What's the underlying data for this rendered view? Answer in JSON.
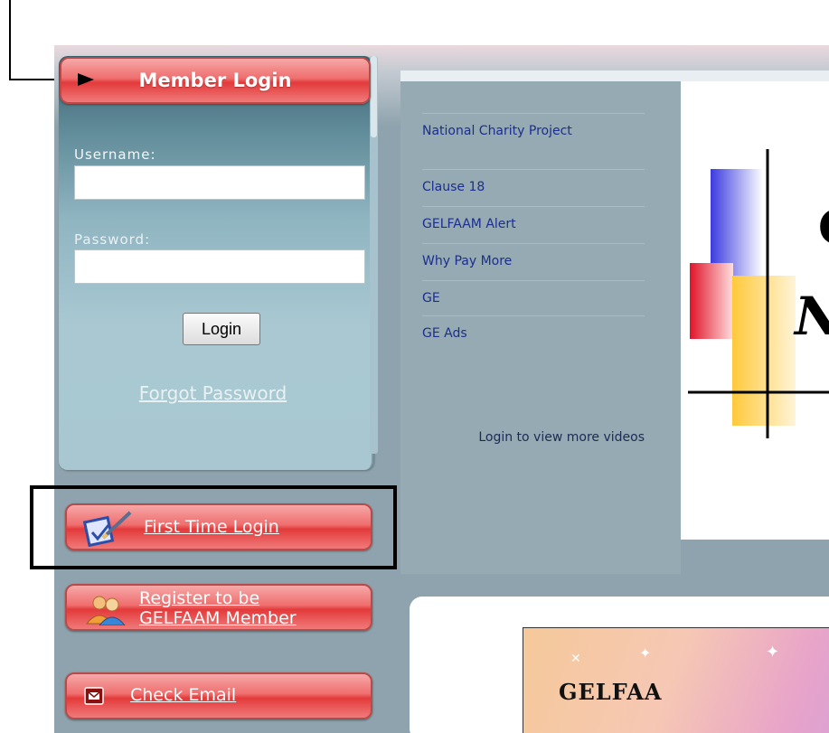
{
  "sidebar": {
    "member_login_title": "Member Login",
    "username_label": "Username:",
    "password_label": "Password:",
    "username_value": "",
    "password_value": "",
    "login_button": "Login",
    "forgot_password": "Forgot Password",
    "first_time_login": "First Time Login",
    "register_line1": "Register to be",
    "register_line2": "GELFAAM Member",
    "check_email": "Check Email"
  },
  "videos": {
    "items": [
      {
        "label": "National Charity Project"
      },
      {
        "label": "Clause 18"
      },
      {
        "label": "GELFAAM Alert"
      },
      {
        "label": "Why Pay More"
      },
      {
        "label": "GE"
      },
      {
        "label": "GE Ads"
      }
    ],
    "more_text": "Login to view more videos"
  },
  "banner": {
    "text": "GELFAA"
  },
  "colors": {
    "button_red": "#e33a3a",
    "panel_teal": "#5f8a97",
    "nav_link": "#1c2e8e",
    "annotation": "#000000"
  }
}
